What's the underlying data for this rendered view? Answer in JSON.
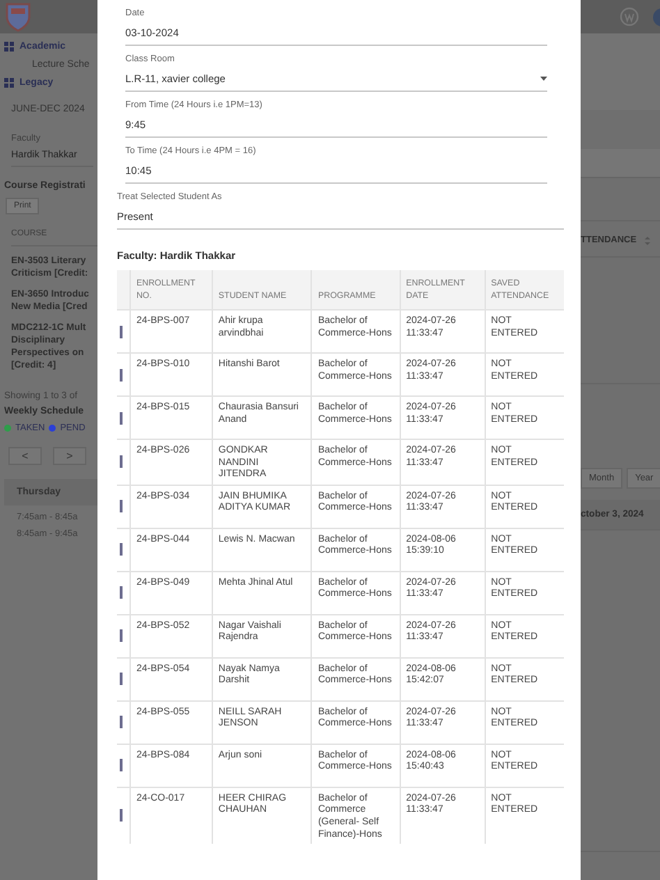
{
  "background_page": {
    "sidebar": {
      "items": [
        {
          "kind": "nav",
          "label": "Academic"
        },
        {
          "kind": "sub",
          "label": "Lecture Sche"
        },
        {
          "kind": "nav",
          "label": "Legacy"
        }
      ]
    },
    "session": "JUNE-DEC 2024",
    "faculty_filter": {
      "label": "Faculty",
      "value": "Hardik Thakkar"
    },
    "course_registration": {
      "title": "Course Registrati",
      "print_button": "Print",
      "column": "COURSE",
      "attendance_column": "TTENDANCE",
      "courses": [
        "EN-3503 Literary Criticism [Credit:",
        "EN-3650 Introduc New Media [Cred",
        "MDC212-1C Mult Disciplinary Perspectives on [Credit: 4]"
      ],
      "showing": "Showing 1 to 3 of"
    },
    "weekly_schedule": {
      "title": "Weekly Schedule",
      "legend": [
        {
          "label": "TAKEN",
          "color": "#2e9e4a"
        },
        {
          "label": "PEND",
          "color": "#2b3fd6"
        }
      ],
      "prev": "<",
      "next": ">",
      "views": [
        "Month",
        "Year"
      ],
      "day": "Thursday",
      "date_heading": "ctober 3, 2024",
      "slots": [
        "7:45am - 8:45a",
        "8:45am - 9:45a"
      ]
    }
  },
  "modal": {
    "fields": [
      {
        "kind": "text",
        "label": "Date",
        "value": "03-10-2024"
      },
      {
        "kind": "select",
        "label": "Class Room",
        "value": "L.R-11, xavier college"
      },
      {
        "kind": "text",
        "label": "From Time (24 Hours i.e 1PM=13)",
        "value": "9:45"
      },
      {
        "kind": "text",
        "label": "To Time (24 Hours i.e 4PM = 16)",
        "value": "10:45"
      },
      {
        "kind": "status",
        "label": "Treat Selected Student As",
        "value": "Present"
      }
    ],
    "faculty_heading": "Faculty: Hardik Thakkar",
    "table": {
      "columns": [
        "ENROLLMENT NO.",
        "STUDENT NAME",
        "PROGRAMME",
        "ENROLLMENT DATE",
        "SAVED ATTENDANCE"
      ],
      "rows": [
        {
          "checked": false,
          "enrollment_no": "24-BPS-007",
          "student_name": "Ahir krupa arvindbhai",
          "programme": "Bachelor of Commerce-Hons",
          "enrollment_date": "2024-07-26 11:33:47",
          "saved_attendance": "NOT ENTERED"
        },
        {
          "checked": false,
          "enrollment_no": "24-BPS-010",
          "student_name": "Hitanshi Barot",
          "programme": "Bachelor of Commerce-Hons",
          "enrollment_date": "2024-07-26 11:33:47",
          "saved_attendance": "NOT ENTERED"
        },
        {
          "checked": false,
          "enrollment_no": "24-BPS-015",
          "student_name": "Chaurasia Bansuri Anand",
          "programme": "Bachelor of Commerce-Hons",
          "enrollment_date": "2024-07-26 11:33:47",
          "saved_attendance": "NOT ENTERED"
        },
        {
          "checked": false,
          "enrollment_no": "24-BPS-026",
          "student_name": "GONDKAR NANDINI JITENDRA",
          "programme": "Bachelor of Commerce-Hons",
          "enrollment_date": "2024-07-26 11:33:47",
          "saved_attendance": "NOT ENTERED"
        },
        {
          "checked": false,
          "enrollment_no": "24-BPS-034",
          "student_name": "JAIN BHUMIKA ADITYA KUMAR",
          "programme": "Bachelor of Commerce-Hons",
          "enrollment_date": "2024-07-26 11:33:47",
          "saved_attendance": "NOT ENTERED"
        },
        {
          "checked": false,
          "enrollment_no": "24-BPS-044",
          "student_name": "Lewis N. Macwan",
          "programme": "Bachelor of Commerce-Hons",
          "enrollment_date": "2024-08-06 15:39:10",
          "saved_attendance": "NOT ENTERED"
        },
        {
          "checked": false,
          "enrollment_no": "24-BPS-049",
          "student_name": "Mehta Jhinal Atul",
          "programme": "Bachelor of Commerce-Hons",
          "enrollment_date": "2024-07-26 11:33:47",
          "saved_attendance": "NOT ENTERED"
        },
        {
          "checked": false,
          "enrollment_no": "24-BPS-052",
          "student_name": "Nagar Vaishali Rajendra",
          "programme": "Bachelor of Commerce-Hons",
          "enrollment_date": "2024-07-26 11:33:47",
          "saved_attendance": "NOT ENTERED"
        },
        {
          "checked": false,
          "enrollment_no": "24-BPS-054",
          "student_name": "Nayak Namya Darshit",
          "programme": "Bachelor of Commerce-Hons",
          "enrollment_date": "2024-08-06 15:42:07",
          "saved_attendance": "NOT ENTERED"
        },
        {
          "checked": false,
          "enrollment_no": "24-BPS-055",
          "student_name": "NEILL SARAH JENSON",
          "programme": "Bachelor of Commerce-Hons",
          "enrollment_date": "2024-07-26 11:33:47",
          "saved_attendance": "NOT ENTERED"
        },
        {
          "checked": false,
          "enrollment_no": "24-BPS-084",
          "student_name": "Arjun soni",
          "programme": "Bachelor of Commerce-Hons",
          "enrollment_date": "2024-08-06 15:40:43",
          "saved_attendance": "NOT ENTERED"
        },
        {
          "checked": false,
          "enrollment_no": "24-CO-017",
          "student_name": "HEER CHIRAG CHAUHAN",
          "programme": "Bachelor of Commerce (General- Self Finance)-Hons",
          "enrollment_date": "2024-07-26 11:33:47",
          "saved_attendance": "NOT ENTERED"
        }
      ]
    }
  }
}
